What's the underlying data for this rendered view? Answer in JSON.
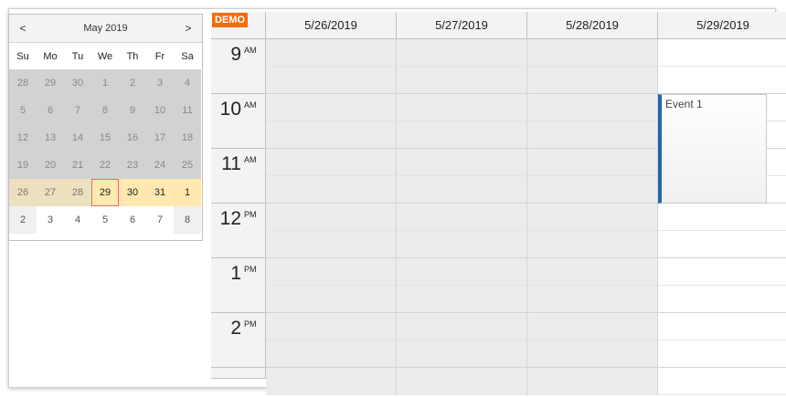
{
  "navigator": {
    "prev": "<",
    "next": ">",
    "month": "May 2019",
    "dow": [
      "Su",
      "Mo",
      "Tu",
      "We",
      "Th",
      "Fr",
      "Sa"
    ],
    "weeks": [
      [
        "28",
        "29",
        "30",
        "1",
        "2",
        "3",
        "4"
      ],
      [
        "5",
        "6",
        "7",
        "8",
        "9",
        "10",
        "11"
      ],
      [
        "12",
        "13",
        "14",
        "15",
        "16",
        "17",
        "18"
      ],
      [
        "19",
        "20",
        "21",
        "22",
        "23",
        "24",
        "25"
      ],
      [
        "26",
        "27",
        "28",
        "29",
        "30",
        "31",
        "1"
      ],
      [
        "2",
        "3",
        "4",
        "5",
        "6",
        "7",
        "8"
      ]
    ]
  },
  "scheduler": {
    "demo_label": "DEMO",
    "columns": [
      "5/26/2019",
      "5/27/2019",
      "5/28/2019",
      "5/29/2019"
    ],
    "hours": [
      {
        "num": "9",
        "ampm": "AM"
      },
      {
        "num": "10",
        "ampm": "AM"
      },
      {
        "num": "11",
        "ampm": "AM"
      },
      {
        "num": "12",
        "ampm": "PM"
      },
      {
        "num": "1",
        "ampm": "PM"
      },
      {
        "num": "2",
        "ampm": "PM"
      }
    ],
    "events": [
      {
        "title": "Event 1",
        "column": 3,
        "start": "10:00 AM",
        "end": "12:00 PM"
      }
    ]
  },
  "colors": {
    "demo_badge": "#f16d10",
    "event_bar": "#2466a8",
    "selected_week": "#ffe9b0",
    "today_border": "#e07070"
  }
}
